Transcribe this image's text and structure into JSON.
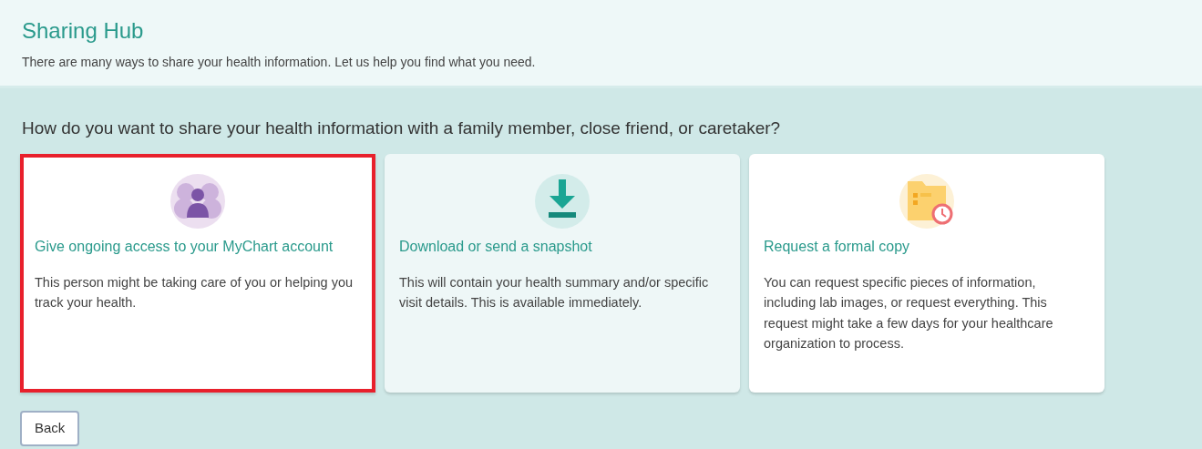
{
  "header": {
    "title": "Sharing Hub",
    "subtitle": "There are many ways to share your health information. Let us help you find what you need."
  },
  "question": "How do you want to share your health information with a family member, close friend, or caretaker?",
  "options": [
    {
      "title": "Give ongoing access to your MyChart account",
      "description": "This person might be taking care of you or helping you track your health.",
      "highlighted": true,
      "hovered": false
    },
    {
      "title": "Download or send a snapshot",
      "description": "This will contain your health summary and/or specific visit details. This is available immediately.",
      "highlighted": false,
      "hovered": true
    },
    {
      "title": "Request a formal copy",
      "description": "You can request specific pieces of information, including lab images, or request everything. This request might take a few days for your healthcare organization to process.",
      "highlighted": false,
      "hovered": false
    }
  ],
  "back_button": "Back"
}
